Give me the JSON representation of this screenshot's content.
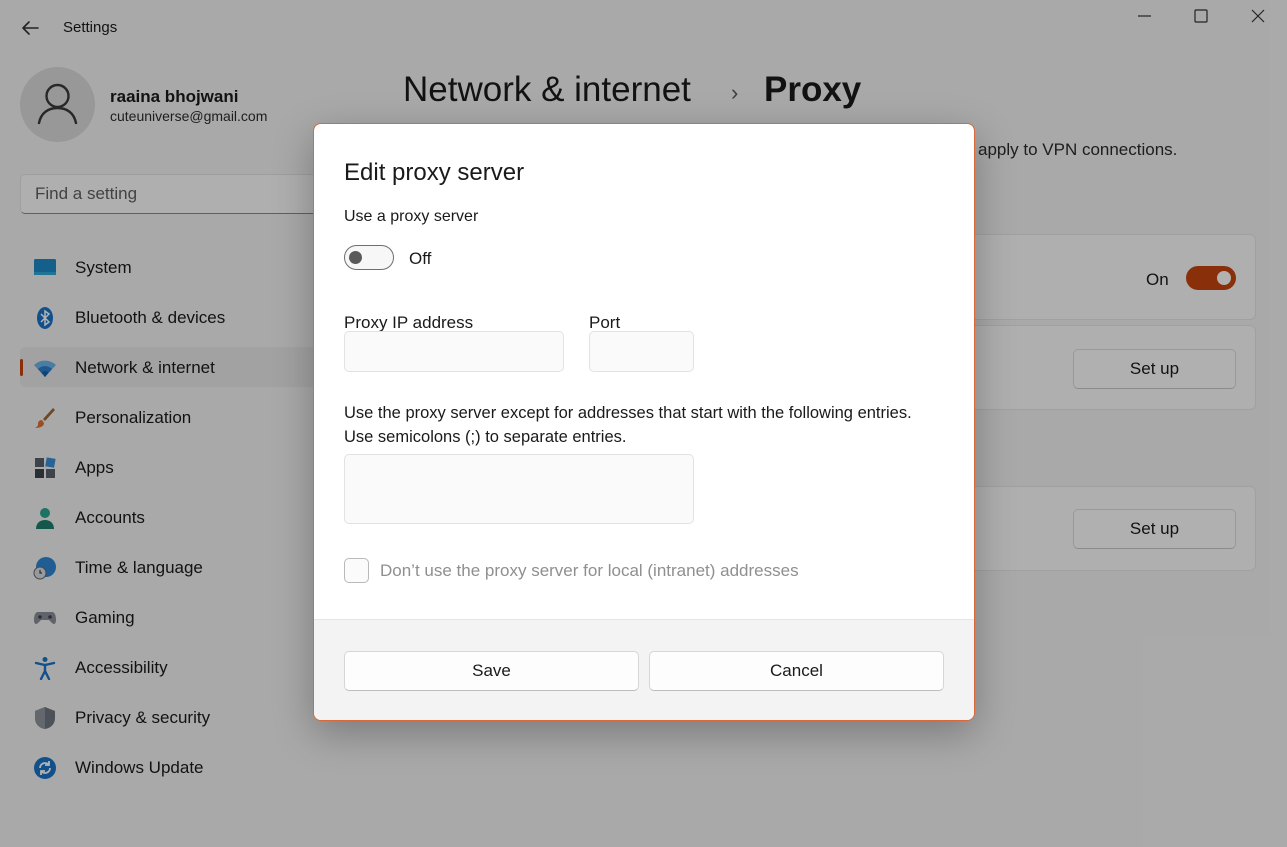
{
  "app": {
    "title": "Settings"
  },
  "user": {
    "name": "raaina bhojwani",
    "email": "cuteuniverse@gmail.com"
  },
  "search": {
    "placeholder": "Find a setting"
  },
  "sidebar": {
    "items": [
      {
        "label": "System",
        "icon": "system-icon"
      },
      {
        "label": "Bluetooth & devices",
        "icon": "bluetooth-icon"
      },
      {
        "label": "Network & internet",
        "icon": "wifi-icon",
        "active": true
      },
      {
        "label": "Personalization",
        "icon": "brush-icon"
      },
      {
        "label": "Apps",
        "icon": "apps-icon"
      },
      {
        "label": "Accounts",
        "icon": "person-icon"
      },
      {
        "label": "Time & language",
        "icon": "globe-clock-icon"
      },
      {
        "label": "Gaming",
        "icon": "gamepad-icon"
      },
      {
        "label": "Accessibility",
        "icon": "accessibility-icon"
      },
      {
        "label": "Privacy & security",
        "icon": "shield-icon"
      },
      {
        "label": "Windows Update",
        "icon": "update-icon"
      }
    ]
  },
  "header": {
    "parent": "Network & internet",
    "separator": "›",
    "current": "Proxy"
  },
  "main": {
    "description_visible": "apply to VPN connections.",
    "auto_detect_state": "On",
    "setup_label_1": "Set up",
    "setup_label_2": "Set up"
  },
  "dialog": {
    "title": "Edit proxy server",
    "use_proxy_label": "Use a proxy server",
    "toggle_state": "Off",
    "ip_label": "Proxy IP address",
    "ip_value": "",
    "port_label": "Port",
    "port_value": "",
    "exceptions_text_line1": "Use the proxy server except for addresses that start with the following entries.",
    "exceptions_text_line2": "Use semicolons (;) to separate entries.",
    "exceptions_value": "",
    "local_checkbox_label": "Don’t use the proxy server for local (intranet) addresses",
    "local_checkbox_checked": false,
    "save_label": "Save",
    "cancel_label": "Cancel"
  },
  "colors": {
    "accent": "#c4460f",
    "dialog_border": "#d9693a",
    "background": "#f3f3f3"
  }
}
